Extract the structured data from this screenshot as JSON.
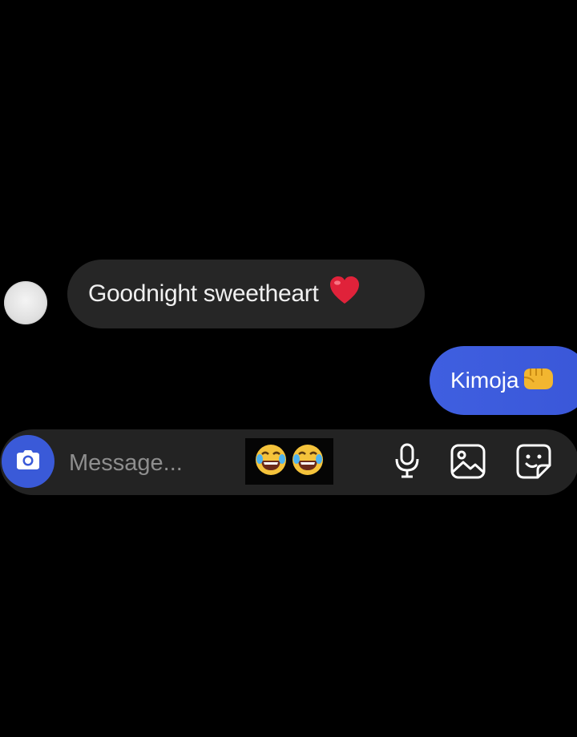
{
  "messages": {
    "incoming": {
      "text": "Goodnight sweetheart",
      "emoji": "heart-icon"
    },
    "outgoing": {
      "text": "Kimoja",
      "emoji": "fist-icon"
    }
  },
  "composer": {
    "placeholder": "Message...",
    "reaction_emojis": [
      "laughing-icon",
      "laughing-icon"
    ],
    "icons": [
      "camera-icon",
      "microphone-icon",
      "gallery-icon",
      "sticker-icon"
    ]
  },
  "colors": {
    "background": "#000000",
    "incoming_bubble": "#262626",
    "outgoing_bubble": "#3b5bdb",
    "composer": "#232323",
    "accent": "#3a5ad8"
  }
}
